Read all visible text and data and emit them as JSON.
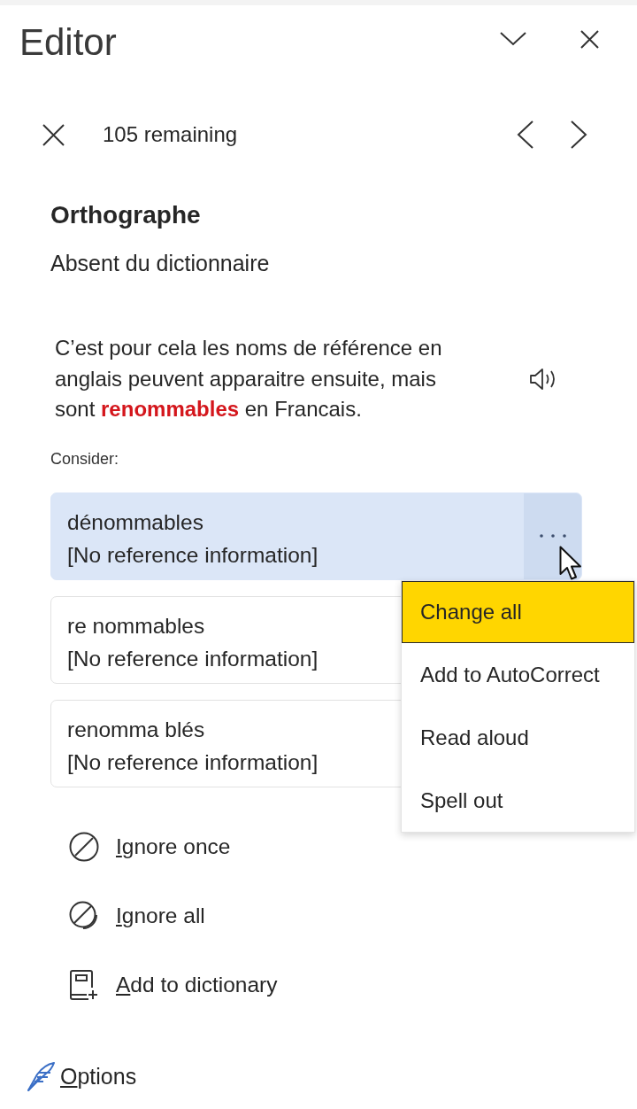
{
  "pane": {
    "title": "Editor"
  },
  "navigation": {
    "remaining": "105 remaining"
  },
  "issue": {
    "category": "Orthographe",
    "description": "Absent du dictionnaire",
    "context": "C’est pour cela les noms de référence en anglais peuvent apparaitre ensuite, mais sont **renommables** en Francais."
  },
  "suggestions_label": "Consider:",
  "suggestions": [
    {
      "word": "dénommables",
      "detail": "[No reference information]",
      "selected": true
    },
    {
      "word": "re nommables",
      "detail": "[No reference information]",
      "selected": false
    },
    {
      "word": "renomma blés",
      "detail": "[No reference information]",
      "selected": false
    }
  ],
  "context_menu": {
    "items": [
      {
        "label": "Change all",
        "selected": true
      },
      {
        "label": "Add to AutoCorrect",
        "selected": false
      },
      {
        "label": "Read aloud",
        "selected": false
      },
      {
        "label": "Spell out",
        "selected": false
      }
    ]
  },
  "actions": [
    {
      "kind": "ignore-once",
      "label": "Ignore once"
    },
    {
      "kind": "ignore-all",
      "label": "Ignore all"
    },
    {
      "kind": "add-to-dictionary",
      "label": "Add to dictionary"
    }
  ],
  "footer": {
    "options": "Options"
  }
}
